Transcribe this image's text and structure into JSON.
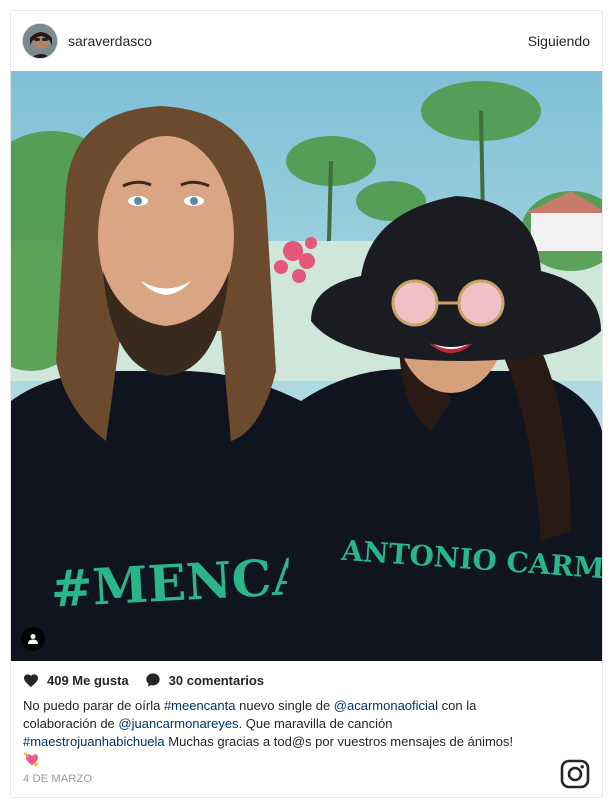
{
  "post": {
    "username": "saraverdasco",
    "follow_label": "Siguiendo",
    "likes": "409 Me gusta",
    "comments": "30 comentarios",
    "caption": {
      "t1": "No puedo parar de oírla ",
      "tag1": "#meencanta",
      "t2": " nuevo single de ",
      "tag2": "@acarmonaoficial",
      "t3": " con la colaboración de ",
      "tag3": "@juancarmonareyes",
      "t4": ". Que maravilla de canción ",
      "tag4": "#maestrojuanhabichuela",
      "t5": " Muchas gracias a tod@s por vuestros mensajes de ánimos! 💘"
    },
    "date": "4 DE MARZO"
  },
  "photo": {
    "shirt_left_text": "#MENCANTA",
    "shirt_right_text": "ANTONIO CARMO"
  },
  "icons": {
    "like": "heart-icon",
    "comment": "comment-icon",
    "user_tag": "user-tag-icon",
    "brand": "instagram-icon"
  },
  "colors": {
    "text": "#262626",
    "link": "#003569",
    "muted": "#999999",
    "shirt_print": "#2bb58a",
    "border": "#e6e6e6"
  }
}
